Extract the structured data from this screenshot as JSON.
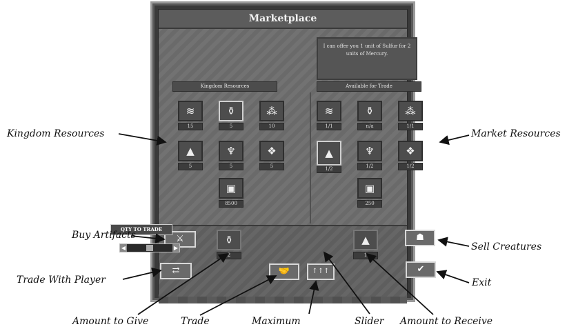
{
  "window": {
    "title": "Marketplace",
    "message": "I can offer you 1 unit of Sulfur for 2 units of Mercury."
  },
  "kingdom": {
    "header": "Kingdom Resources",
    "items": [
      {
        "icon": "wood-icon",
        "glyph": "≋",
        "value": "15"
      },
      {
        "icon": "mercury-icon",
        "glyph": "⚱",
        "value": "5"
      },
      {
        "icon": "ore-icon",
        "glyph": "⁂",
        "value": "10"
      },
      {
        "icon": "sulfur-icon",
        "glyph": "▲",
        "value": "5"
      },
      {
        "icon": "crystal-icon",
        "glyph": "♆",
        "value": "5"
      },
      {
        "icon": "gems-icon",
        "glyph": "❖",
        "value": "5"
      },
      {
        "icon": "gold-icon",
        "glyph": "▣",
        "value": "8500"
      }
    ]
  },
  "market": {
    "header": "Available for Trade",
    "items": [
      {
        "icon": "wood-icon",
        "glyph": "≋",
        "value": "1/1"
      },
      {
        "icon": "mercury-icon",
        "glyph": "⚱",
        "value": "n/a"
      },
      {
        "icon": "ore-icon",
        "glyph": "⁂",
        "value": "1/1"
      },
      {
        "icon": "sulfur-icon",
        "glyph": "▲",
        "value": "1/2"
      },
      {
        "icon": "crystal-icon",
        "glyph": "♆",
        "value": "1/2"
      },
      {
        "icon": "gems-icon",
        "glyph": "❖",
        "value": "1/2"
      },
      {
        "icon": "gold-icon",
        "glyph": "▣",
        "value": "250"
      }
    ]
  },
  "trade": {
    "qty_label": "QTY TO TRADE",
    "give_amount": "2",
    "receive_amount": "1",
    "slider_level": 0.5
  },
  "annotations": {
    "kingdom_resources": "Kingdom Resources",
    "market_resources": "Market Resources",
    "buy_artifacts": "Buy Artifacts",
    "sell_creatures": "Sell Creatures",
    "trade_with_player": "Trade With Player",
    "exit": "Exit",
    "amount_to_give": "Amount to Give",
    "trade": "Trade",
    "maximum": "Maximum",
    "slider": "Slider",
    "amount_to_receive": "Amount to Receive"
  },
  "colors": {
    "frame": "#3a3a3a",
    "panel": "#6a6a6a",
    "highlight": "#e0e0e0"
  }
}
